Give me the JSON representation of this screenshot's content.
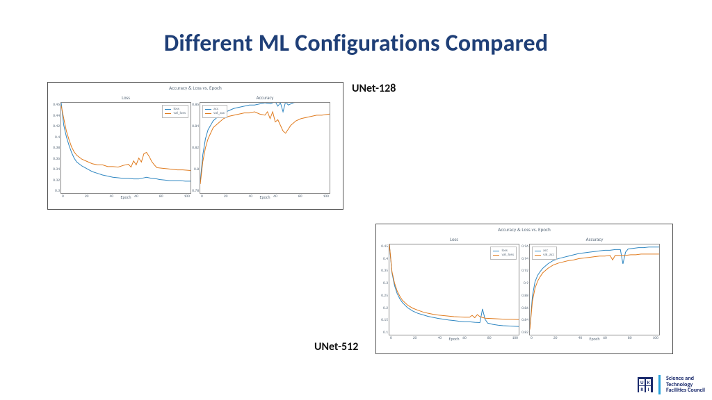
{
  "title": "Different ML Configurations Compared",
  "labels": {
    "tl": "UNet-128",
    "br": "UNet-512"
  },
  "footer": {
    "org_line1": "Science and",
    "org_line2": "Technology",
    "org_line3": "Facilities Council",
    "ukri": [
      "U",
      "K",
      "R",
      "I"
    ]
  },
  "chart_data": [
    {
      "config": "UNet-128",
      "super_title": "Accuracy & Loss vs. Epoch",
      "xlabel": "Epoch",
      "x_ticks": [
        0,
        20,
        40,
        60,
        80,
        100
      ],
      "panels": [
        {
          "title": "Loss",
          "type": "line",
          "ylim": [
            0.3,
            0.46
          ],
          "y_ticks": [
            0.3,
            0.32,
            0.34,
            0.36,
            0.38,
            0.4,
            0.42,
            0.44,
            0.46
          ],
          "legend": [
            "loss",
            "val_loss"
          ],
          "series": [
            {
              "name": "loss",
              "x": [
                0,
                2,
                4,
                6,
                8,
                10,
                12,
                16,
                20,
                24,
                28,
                32,
                36,
                40,
                44,
                48,
                52,
                56,
                60,
                64,
                66,
                70,
                74,
                76,
                80,
                84,
                88,
                92,
                96,
                100
              ],
              "y": [
                0.46,
                0.42,
                0.4,
                0.385,
                0.372,
                0.362,
                0.355,
                0.348,
                0.343,
                0.338,
                0.335,
                0.332,
                0.33,
                0.328,
                0.327,
                0.326,
                0.326,
                0.325,
                0.325,
                0.327,
                0.328,
                0.326,
                0.325,
                0.324,
                0.323,
                0.322,
                0.322,
                0.322,
                0.321,
                0.321
              ]
            },
            {
              "name": "val_loss",
              "x": [
                0,
                2,
                4,
                6,
                8,
                10,
                12,
                16,
                20,
                24,
                28,
                32,
                36,
                40,
                44,
                48,
                52,
                54,
                56,
                58,
                60,
                62,
                64,
                66,
                68,
                70,
                72,
                74,
                78,
                82,
                86,
                90,
                94,
                100
              ],
              "y": [
                0.455,
                0.432,
                0.41,
                0.395,
                0.382,
                0.373,
                0.367,
                0.36,
                0.356,
                0.352,
                0.35,
                0.35,
                0.347,
                0.347,
                0.346,
                0.349,
                0.351,
                0.346,
                0.357,
                0.35,
                0.362,
                0.355,
                0.37,
                0.372,
                0.365,
                0.356,
                0.35,
                0.345,
                0.344,
                0.343,
                0.342,
                0.341,
                0.341,
                0.34
              ]
            }
          ]
        },
        {
          "title": "Accuracy",
          "type": "line",
          "ylim": [
            0.78,
            0.86
          ],
          "y_ticks": [
            0.78,
            0.8,
            0.82,
            0.84,
            0.86
          ],
          "legend": [
            "acc",
            "val_acc"
          ],
          "series": [
            {
              "name": "acc",
              "x": [
                0,
                2,
                4,
                6,
                8,
                10,
                14,
                18,
                22,
                26,
                30,
                34,
                38,
                42,
                46,
                50,
                54,
                58,
                60,
                62,
                64,
                66,
                68,
                72,
                76,
                80,
                84,
                88,
                92,
                96,
                100
              ],
              "y": [
                0.79,
                0.814,
                0.828,
                0.836,
                0.84,
                0.844,
                0.848,
                0.851,
                0.853,
                0.855,
                0.856,
                0.857,
                0.858,
                0.858,
                0.859,
                0.86,
                0.859,
                0.861,
                0.857,
                0.86,
                0.852,
                0.861,
                0.858,
                0.86,
                0.861,
                0.862,
                0.862,
                0.862,
                0.862,
                0.862,
                0.862
              ]
            },
            {
              "name": "val_acc",
              "x": [
                0,
                2,
                4,
                6,
                8,
                10,
                14,
                18,
                22,
                26,
                30,
                34,
                38,
                42,
                46,
                50,
                52,
                54,
                56,
                58,
                60,
                62,
                64,
                66,
                70,
                74,
                78,
                82,
                86,
                90,
                94,
                100
              ],
              "y": [
                0.788,
                0.808,
                0.82,
                0.828,
                0.833,
                0.838,
                0.842,
                0.846,
                0.848,
                0.849,
                0.85,
                0.851,
                0.851,
                0.852,
                0.85,
                0.849,
                0.852,
                0.846,
                0.852,
                0.843,
                0.845,
                0.84,
                0.835,
                0.833,
                0.84,
                0.844,
                0.846,
                0.847,
                0.848,
                0.849,
                0.849,
                0.85
              ]
            }
          ]
        }
      ]
    },
    {
      "config": "UNet-512",
      "super_title": "Accuracy & Loss vs. Epoch",
      "xlabel": "Epoch",
      "x_ticks": [
        0,
        20,
        40,
        60,
        80,
        100
      ],
      "panels": [
        {
          "title": "Loss",
          "type": "line",
          "ylim": [
            0.1,
            0.45
          ],
          "y_ticks": [
            0.1,
            0.15,
            0.2,
            0.25,
            0.3,
            0.35,
            0.4,
            0.45
          ],
          "legend": [
            "loss",
            "val_loss"
          ],
          "series": [
            {
              "name": "loss",
              "x": [
                0,
                2,
                4,
                6,
                8,
                10,
                14,
                18,
                22,
                26,
                30,
                34,
                38,
                42,
                46,
                50,
                54,
                58,
                62,
                66,
                70,
                72,
                74,
                76,
                80,
                84,
                88,
                92,
                96,
                100
              ],
              "y": [
                0.45,
                0.34,
                0.29,
                0.26,
                0.24,
                0.225,
                0.205,
                0.192,
                0.183,
                0.177,
                0.171,
                0.167,
                0.163,
                0.16,
                0.157,
                0.155,
                0.152,
                0.15,
                0.15,
                0.148,
                0.147,
                0.2,
                0.16,
                0.145,
                0.14,
                0.137,
                0.135,
                0.134,
                0.133,
                0.132
              ]
            },
            {
              "name": "val_loss",
              "x": [
                0,
                2,
                4,
                6,
                8,
                10,
                14,
                18,
                22,
                26,
                30,
                34,
                38,
                42,
                46,
                50,
                54,
                58,
                62,
                64,
                66,
                68,
                70,
                74,
                78,
                82,
                86,
                90,
                94,
                100
              ],
              "y": [
                0.45,
                0.345,
                0.3,
                0.27,
                0.25,
                0.234,
                0.215,
                0.203,
                0.195,
                0.188,
                0.183,
                0.179,
                0.176,
                0.174,
                0.172,
                0.17,
                0.169,
                0.168,
                0.168,
                0.175,
                0.166,
                0.178,
                0.17,
                0.164,
                0.163,
                0.162,
                0.161,
                0.16,
                0.16,
                0.159
              ]
            }
          ]
        },
        {
          "title": "Accuracy",
          "type": "line",
          "ylim": [
            0.82,
            0.96
          ],
          "y_ticks": [
            0.82,
            0.84,
            0.86,
            0.88,
            0.9,
            0.92,
            0.94,
            0.96
          ],
          "legend": [
            "acc",
            "val_acc"
          ],
          "series": [
            {
              "name": "acc",
              "x": [
                0,
                2,
                4,
                6,
                8,
                10,
                14,
                18,
                22,
                26,
                30,
                34,
                38,
                42,
                46,
                50,
                54,
                58,
                62,
                66,
                70,
                72,
                74,
                76,
                80,
                84,
                88,
                92,
                96,
                100
              ],
              "y": [
                0.83,
                0.88,
                0.902,
                0.912,
                0.918,
                0.923,
                0.93,
                0.935,
                0.938,
                0.94,
                0.942,
                0.944,
                0.946,
                0.947,
                0.948,
                0.949,
                0.95,
                0.951,
                0.951,
                0.952,
                0.952,
                0.93,
                0.948,
                0.953,
                0.954,
                0.955,
                0.955,
                0.956,
                0.956,
                0.956
              ]
            },
            {
              "name": "val_acc",
              "x": [
                0,
                2,
                4,
                6,
                8,
                10,
                14,
                18,
                22,
                26,
                30,
                34,
                38,
                42,
                46,
                50,
                54,
                58,
                62,
                64,
                66,
                70,
                74,
                78,
                82,
                86,
                90,
                94,
                100
              ],
              "y": [
                0.828,
                0.872,
                0.892,
                0.903,
                0.91,
                0.916,
                0.923,
                0.928,
                0.931,
                0.933,
                0.935,
                0.936,
                0.938,
                0.939,
                0.94,
                0.941,
                0.942,
                0.942,
                0.943,
                0.936,
                0.943,
                0.943,
                0.943,
                0.944,
                0.944,
                0.945,
                0.945,
                0.945,
                0.945
              ]
            }
          ]
        }
      ]
    }
  ]
}
